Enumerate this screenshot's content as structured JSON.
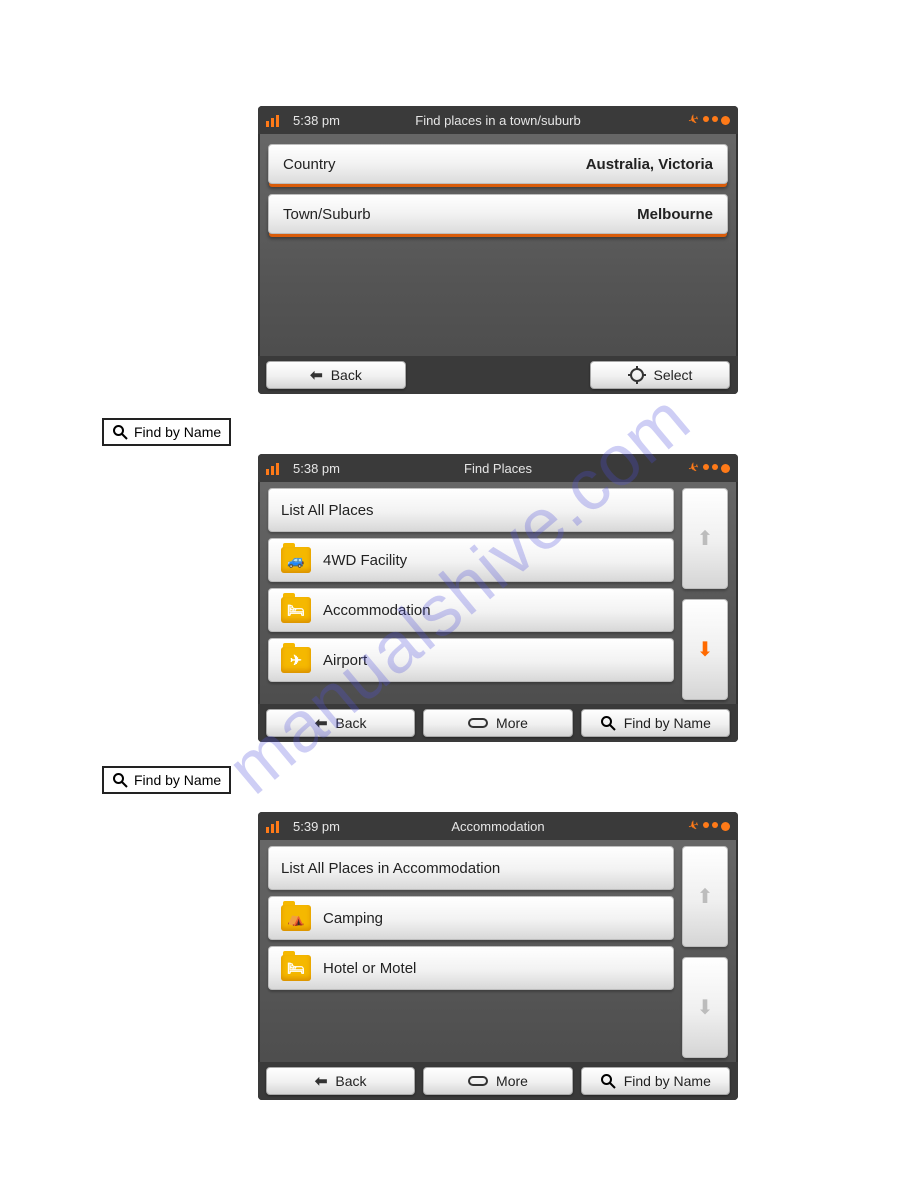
{
  "watermark": "manualshive.com",
  "screen1": {
    "time": "5:38 pm",
    "title": "Find places in a town/suburb",
    "rows": [
      {
        "label": "Country",
        "value": "Australia, Victoria"
      },
      {
        "label": "Town/Suburb",
        "value": "Melbourne"
      }
    ],
    "back": "Back",
    "select": "Select"
  },
  "find_by_name_btn": "Find by Name",
  "screen2": {
    "time": "5:38 pm",
    "title": "Find Places",
    "list_all": "List All Places",
    "items": [
      {
        "label": "4WD Facility",
        "glyph": "🚙"
      },
      {
        "label": "Accommodation",
        "glyph": "🛏"
      },
      {
        "label": "Airport",
        "glyph": "✈"
      }
    ],
    "back": "Back",
    "more": "More",
    "find": "Find by Name"
  },
  "screen3": {
    "time": "5:39 pm",
    "title": "Accommodation",
    "list_all": "List All Places in Accommodation",
    "items": [
      {
        "label": "Camping",
        "glyph": "⛺"
      },
      {
        "label": "Hotel or Motel",
        "glyph": "🛏"
      }
    ],
    "back": "Back",
    "more": "More",
    "find": "Find by Name"
  }
}
